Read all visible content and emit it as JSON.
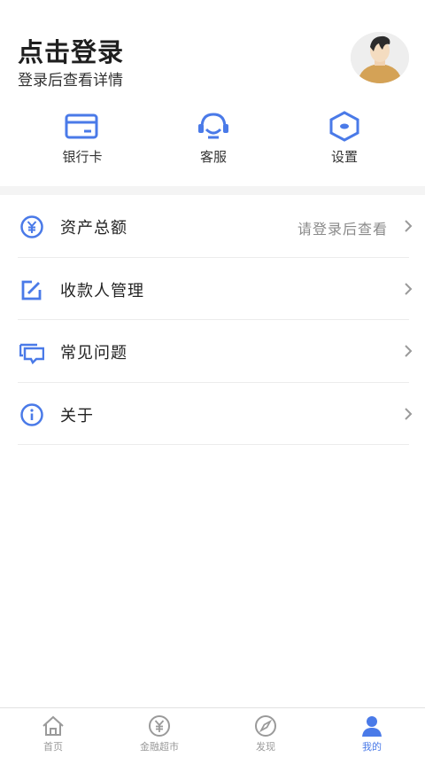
{
  "header": {
    "title": "点击登录",
    "subtitle": "登录后查看详情"
  },
  "quick_actions": [
    {
      "label": "银行卡",
      "icon": "bank-card-icon"
    },
    {
      "label": "客服",
      "icon": "headset-icon"
    },
    {
      "label": "设置",
      "icon": "settings-hexagon-icon"
    }
  ],
  "menu": [
    {
      "label": "资产总额",
      "hint": "请登录后查看",
      "icon": "yuan-circle-icon"
    },
    {
      "label": "收款人管理",
      "hint": "",
      "icon": "edit-square-icon"
    },
    {
      "label": "常见问题",
      "hint": "",
      "icon": "chat-bubbles-icon"
    },
    {
      "label": "关于",
      "hint": "",
      "icon": "info-circle-icon"
    }
  ],
  "tabbar": [
    {
      "label": "首页",
      "icon": "home-icon",
      "active": false
    },
    {
      "label": "金融超市",
      "icon": "yuan-coin-icon",
      "active": false
    },
    {
      "label": "发现",
      "icon": "compass-icon",
      "active": false
    },
    {
      "label": "我的",
      "icon": "user-icon",
      "active": true
    }
  ],
  "colors": {
    "accent": "#4a7ae8",
    "inactive": "#9a9a9a",
    "separator": "#f4f4f4"
  }
}
